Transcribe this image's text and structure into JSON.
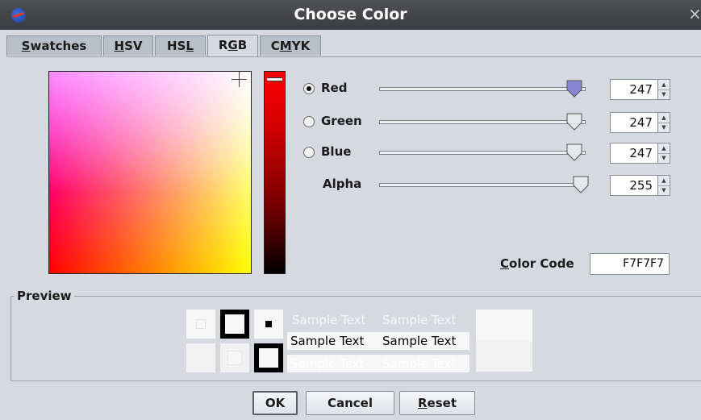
{
  "window": {
    "title": "Choose Color",
    "close_glyph": "×",
    "app_icon": "nasa-logo-icon"
  },
  "tabs": [
    {
      "pre": "",
      "mnemonic": "S",
      "post": "watches",
      "active": false
    },
    {
      "pre": "",
      "mnemonic": "H",
      "post": "SV",
      "active": false
    },
    {
      "pre": "HS",
      "mnemonic": "L",
      "post": "",
      "active": false
    },
    {
      "pre": "R",
      "mnemonic": "G",
      "post": "B",
      "active": true
    },
    {
      "pre": "C",
      "mnemonic": "M",
      "post": "YK",
      "active": false
    }
  ],
  "channels": [
    {
      "label": "Red",
      "radio": true,
      "selected": true,
      "value": "247",
      "level": 0.969
    },
    {
      "label": "Green",
      "radio": true,
      "selected": false,
      "value": "247",
      "level": 0.969
    },
    {
      "label": "Blue",
      "radio": true,
      "selected": false,
      "value": "247",
      "level": 0.969
    },
    {
      "label": "Alpha",
      "radio": false,
      "selected": false,
      "value": "255",
      "level": 1.0
    }
  ],
  "color_code": {
    "label_mnemonic": "C",
    "label_rest": "olor Code",
    "value": "F7F7F7"
  },
  "preview": {
    "label": "Preview",
    "sample_text": "Sample Text",
    "color": "#f7f7f7"
  },
  "buttons": {
    "ok": "OK",
    "cancel": "Cancel",
    "reset_mnemonic": "R",
    "reset_rest": "eset"
  },
  "colors": {
    "selected": "#f7f7f7",
    "thumb_active": "#8a86d8",
    "thumb_inactive": "#e6e8ec"
  }
}
